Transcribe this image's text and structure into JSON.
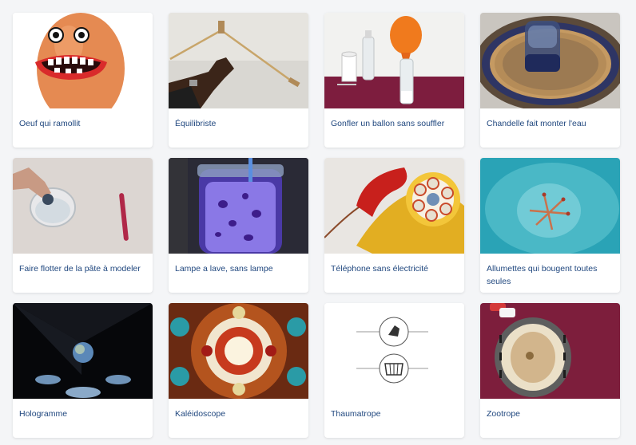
{
  "cards": [
    {
      "title": "Oeuf qui ramollit",
      "image": "egg-with-face-image"
    },
    {
      "title": "Équilibriste",
      "image": "balancing-skewers-image"
    },
    {
      "title": "Gonfler un ballon sans souffler",
      "image": "balloon-on-bottle-image"
    },
    {
      "title": "Chandelle fait monter l'eau",
      "image": "candle-under-glass-image"
    },
    {
      "title": "Faire flotter de la pâte à modeler",
      "image": "floating-clay-image"
    },
    {
      "title": "Lampe a lave, sans lampe",
      "image": "lava-lamp-jar-image"
    },
    {
      "title": "Téléphone sans électricité",
      "image": "toy-telephone-image"
    },
    {
      "title": "Allumettes qui bougent toutes seules",
      "image": "moving-matches-image"
    },
    {
      "title": "Hologramme",
      "image": "hologram-pyramid-image"
    },
    {
      "title": "Kaléidoscope",
      "image": "kaleidoscope-pattern-image"
    },
    {
      "title": "Thaumatrope",
      "image": "thaumatrope-disc-image"
    },
    {
      "title": "Zootrope",
      "image": "zootrope-drum-image"
    }
  ]
}
